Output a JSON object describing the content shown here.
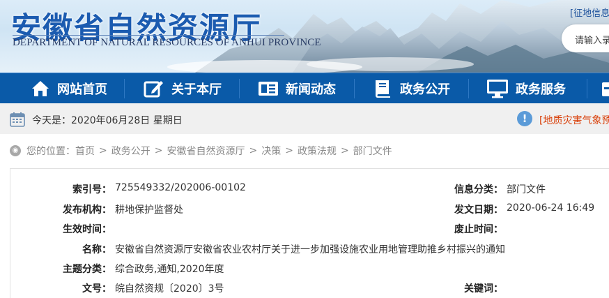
{
  "header": {
    "title_zh": "安徽省自然资源厅",
    "title_en": "DEPARTMENT OF NATURAL RESOURCES OF ANHUI PROVINCE",
    "top_link": "[征地信息",
    "search_placeholder": "请输入录"
  },
  "nav": {
    "items": [
      {
        "label": "网站首页",
        "icon": "home-icon"
      },
      {
        "label": "关于本厅",
        "icon": "edit-icon"
      },
      {
        "label": "新闻动态",
        "icon": "news-icon"
      },
      {
        "label": "政务公开",
        "icon": "book-icon"
      },
      {
        "label": "政务服务",
        "icon": "monitor-icon"
      }
    ]
  },
  "infobar": {
    "date_text": "今天是：2020年06月28日 星期日",
    "notice_text": "[地质灾害气象预"
  },
  "breadcrumb": {
    "prefix": "您的位置：",
    "items": [
      "首页",
      "政务公开",
      "安徽省自然资源厅",
      "决策",
      "政策法规",
      "部门文件"
    ],
    "separator": ">"
  },
  "meta": {
    "index_no_label": "索引号：",
    "index_no": "725549332/202006-00102",
    "category_label": "信息分类：",
    "category": "部门文件",
    "publisher_label": "发布机构：",
    "publisher": "耕地保护监督处",
    "issue_date_label": "发文日期：",
    "issue_date": "2020-06-24 16:49",
    "effective_label": "生效时间：",
    "effective": "",
    "abolish_label": "废止时间：",
    "abolish": "",
    "name_label": "名称：",
    "name": "安徽省自然资源厅安徽省农业农村厅关于进一步加强设施农业用地管理助推乡村振兴的通知",
    "topic_label": "主题分类：",
    "topic": "综合政务,通知,2020年度",
    "doc_no_label": "文号：",
    "doc_no": "皖自然资规〔2020〕3号",
    "keywords_label": "关键词：",
    "keywords": ""
  }
}
